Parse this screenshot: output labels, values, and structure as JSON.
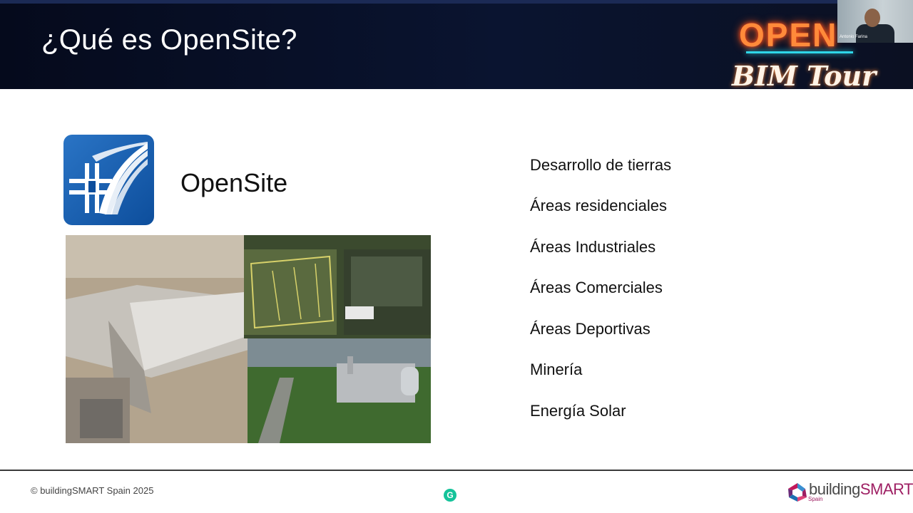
{
  "slide": {
    "title": "¿Qué es OpenSite?",
    "product_name": "OpenSite",
    "features": [
      "Desarrollo de tierras",
      "Áreas residenciales",
      "Áreas Industriales",
      "Áreas Comerciales",
      "Áreas Deportivas",
      "Minería",
      "Energía Solar"
    ]
  },
  "event_logo": {
    "open_text": "OPEN",
    "bim_tour_text": "BIM Tour"
  },
  "webcam": {
    "presenter_name": "Antonio Farina"
  },
  "footer": {
    "copyright": "© buildingSMART Spain 2025",
    "logo_text_building": "building",
    "logo_text_smart": "SMART",
    "logo_sub": "Spain",
    "grammarly_icon": "G"
  },
  "colors": {
    "header_bg": "#0a1430",
    "accent_blue": "#0d4e9c",
    "brand_magenta": "#9e1f63"
  }
}
